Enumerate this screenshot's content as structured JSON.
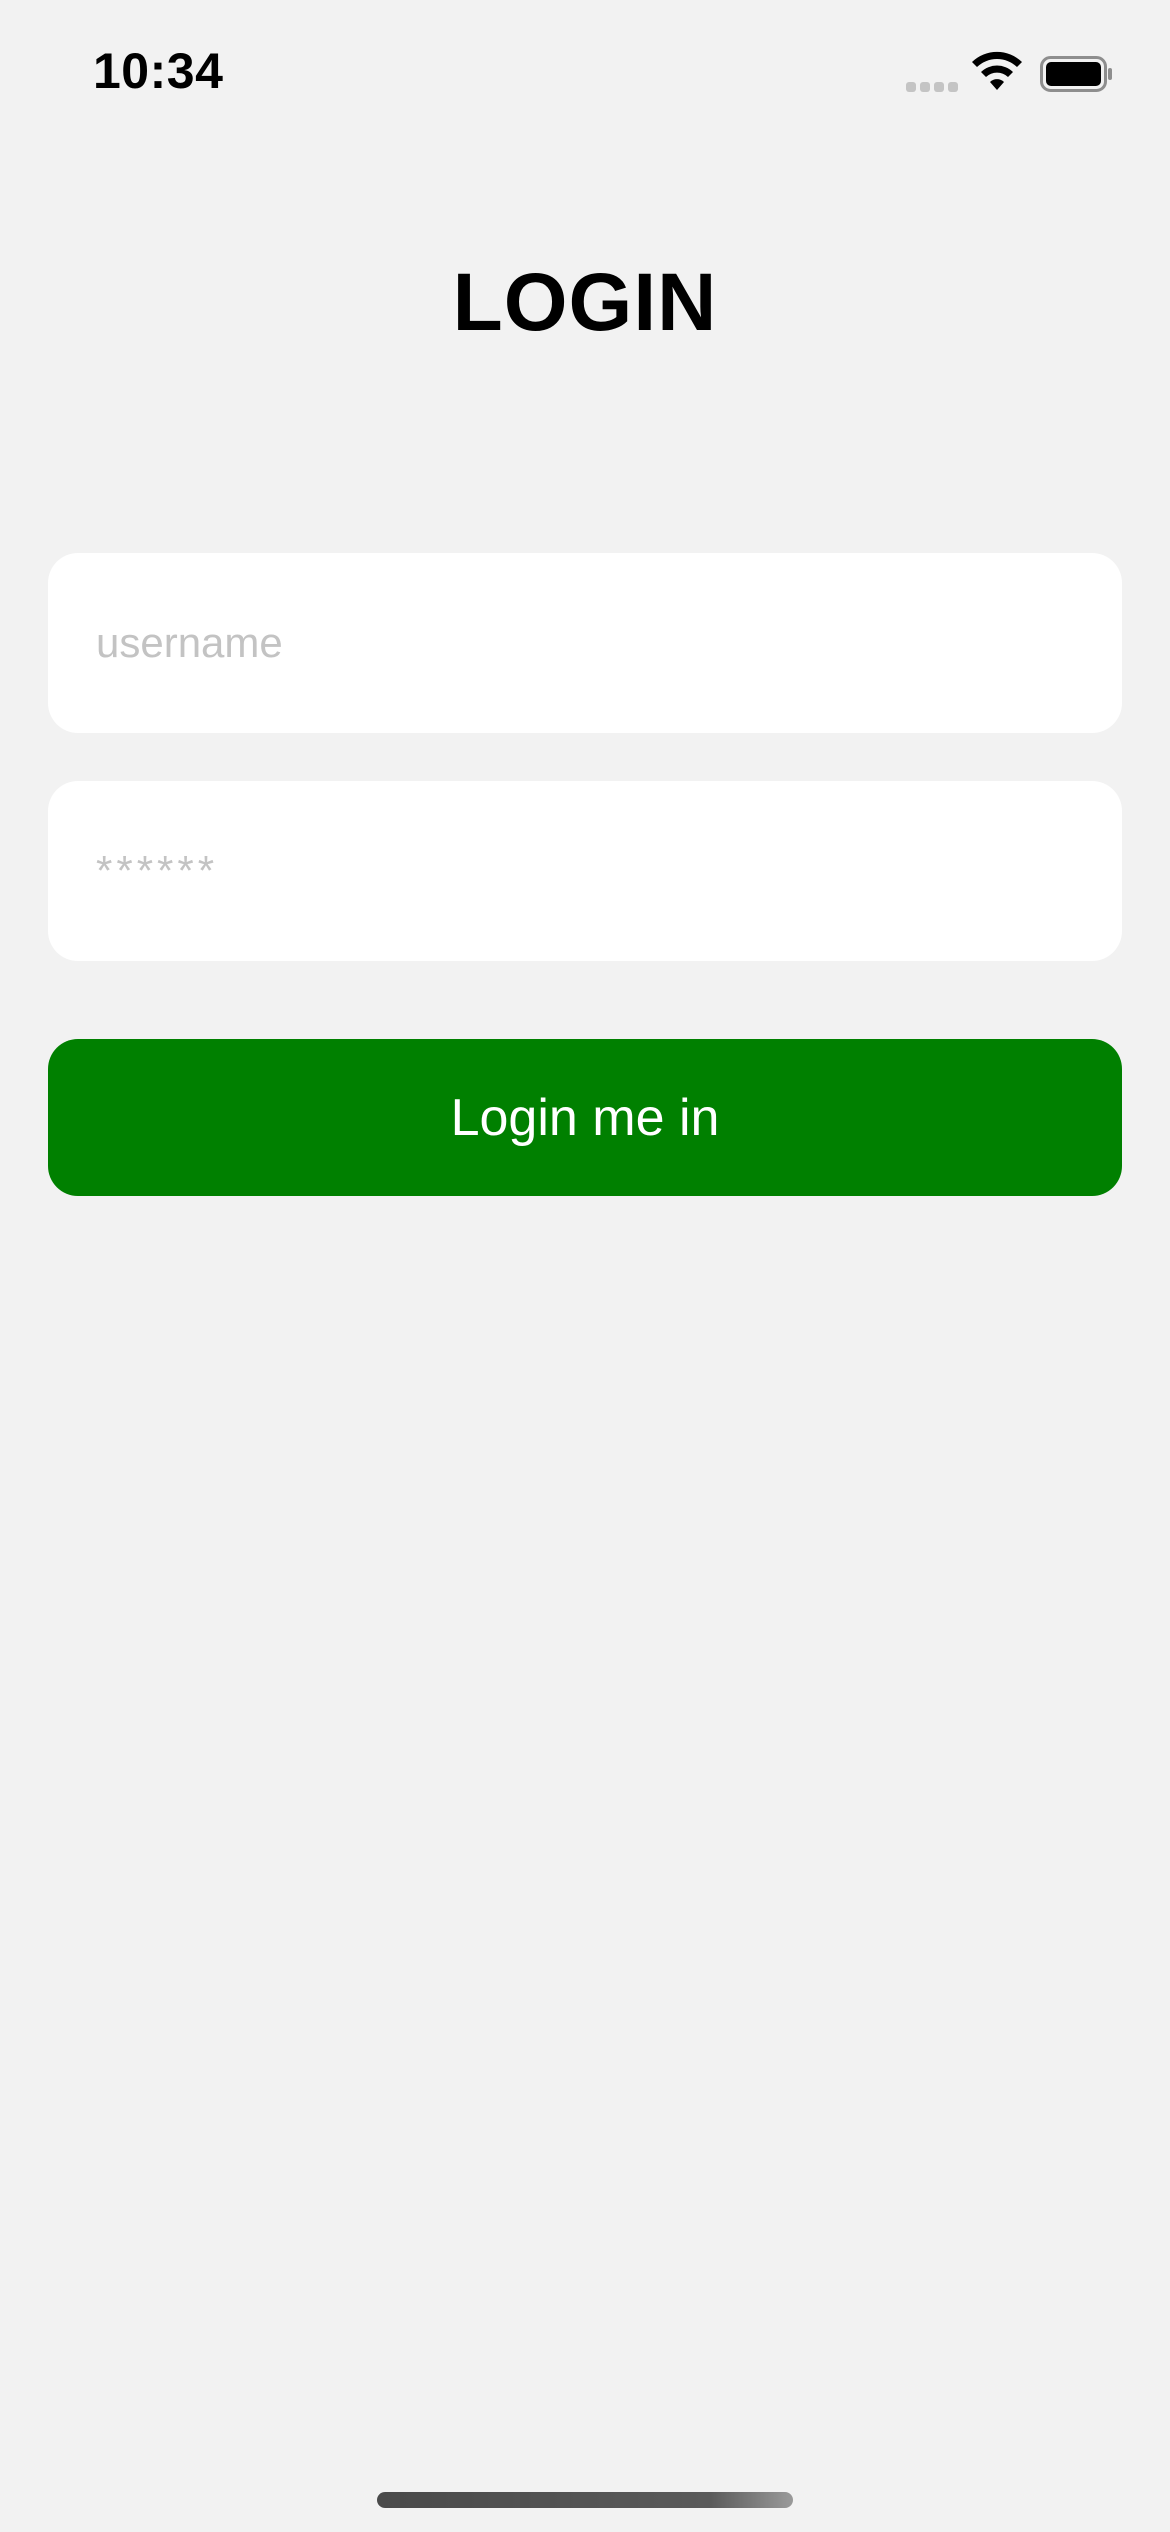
{
  "status_bar": {
    "time": "10:34",
    "icons": [
      "cellular-signal-icon",
      "wifi-icon",
      "battery-icon"
    ]
  },
  "login": {
    "title": "LOGIN",
    "username_placeholder": "username",
    "password_placeholder": "******",
    "button_label": "Login me in"
  },
  "colors": {
    "background": "#f2f2f2",
    "field_background": "#ffffff",
    "placeholder": "#c3c3c3",
    "button": "#008000",
    "button_text": "#ffffff"
  }
}
